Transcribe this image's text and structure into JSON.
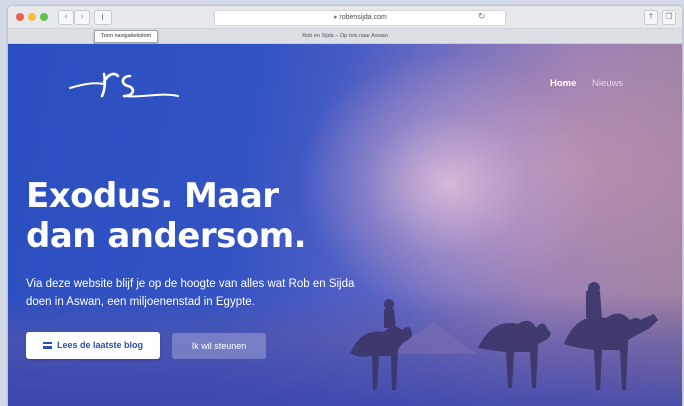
{
  "browser": {
    "address": "robensijda.com",
    "tab_title": "Rob en Sijda – Op reis naar Aswan",
    "tooltip": "Toon navigatiekolom"
  },
  "site": {
    "nav": {
      "home": "Home",
      "news": "Nieuws"
    },
    "hero": {
      "title_line1": "Exodus. Maar",
      "title_line2": "dan andersom.",
      "subtitle": "Via deze website blijf je op de hoogte van alles wat Rob en Sijda doen in Aswan, een miljoenenstad in Egypte.",
      "primary_button": "Lees de laatste blog",
      "secondary_button": "Ik wil steunen"
    }
  },
  "colors": {
    "accent": "#2b4eb7",
    "hero_blue": "#2a4ec0",
    "white": "#ffffff"
  },
  "icons": {
    "menu": "menu-lines-icon",
    "lock": "lock-icon",
    "reload": "reload-icon",
    "share": "share-icon",
    "tabs": "tabs-icon"
  }
}
